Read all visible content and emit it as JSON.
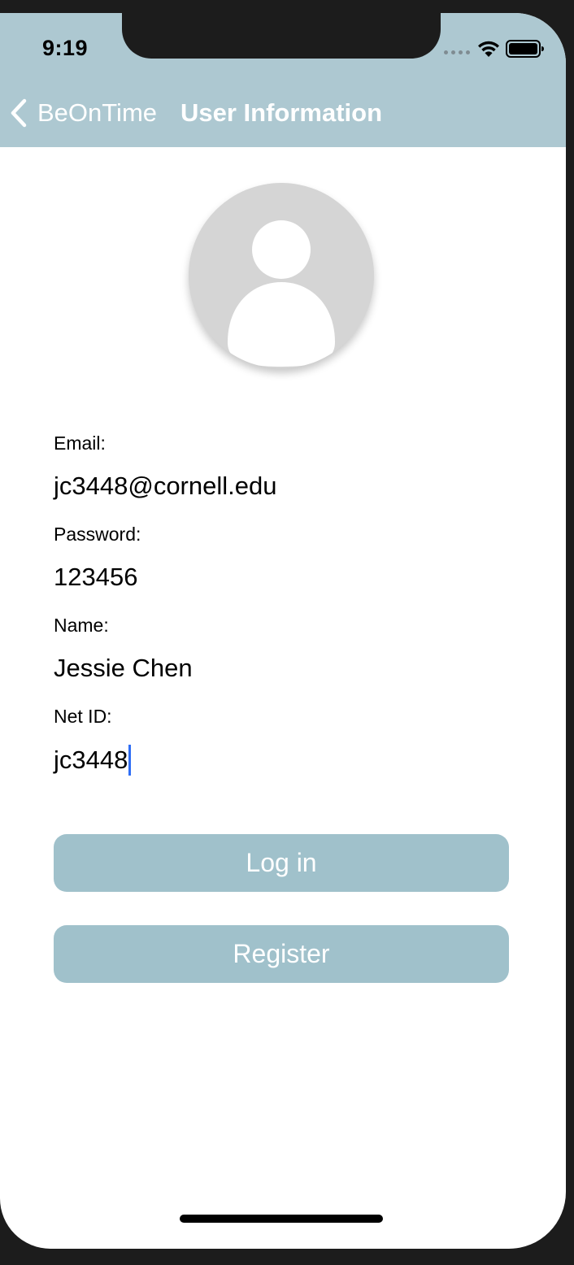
{
  "status_bar": {
    "time": "9:19"
  },
  "nav": {
    "back_label": "BeOnTime",
    "title": "User Information"
  },
  "profile": {
    "avatar_icon": "person-placeholder-icon"
  },
  "fields": [
    {
      "label": "Email:",
      "value": "jc3448@cornell.edu"
    },
    {
      "label": "Password:",
      "value": "123456"
    },
    {
      "label": "Name:",
      "value": "Jessie Chen"
    },
    {
      "label": "Net ID:",
      "value": "jc3448"
    }
  ],
  "buttons": {
    "login_label": "Log in",
    "register_label": "Register"
  },
  "colors": {
    "header": "#adc8d1",
    "button": "#a0c1cb",
    "cursor": "#2f6ef5"
  }
}
